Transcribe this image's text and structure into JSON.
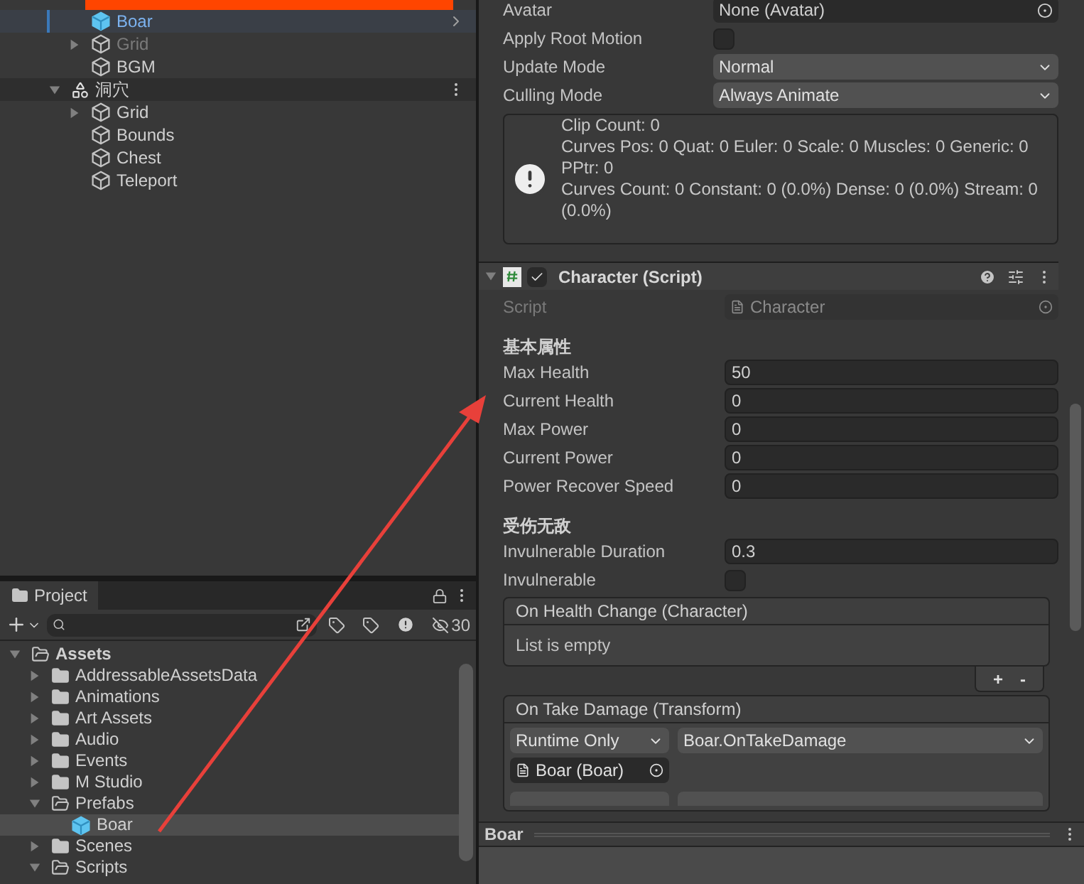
{
  "hierarchy": {
    "items": [
      {
        "label": "Boar",
        "kind": "prefab",
        "selected": true,
        "disabled": false
      },
      {
        "label": "Grid",
        "kind": "object",
        "expanded": false,
        "selected": false,
        "disabled": true
      },
      {
        "label": "BGM",
        "kind": "object",
        "selected": false,
        "disabled": false
      }
    ],
    "scenes": [
      {
        "label": "洞穴",
        "expanded": true,
        "children": [
          {
            "label": "Grid",
            "kind": "object",
            "expanded": false,
            "selected": false,
            "disabled": false
          },
          {
            "label": "Bounds",
            "kind": "object",
            "selected": false,
            "disabled": false
          },
          {
            "label": "Chest",
            "kind": "object",
            "selected": false,
            "disabled": false
          },
          {
            "label": "Teleport",
            "kind": "object",
            "selected": false,
            "disabled": false
          }
        ]
      }
    ]
  },
  "project": {
    "tab": "Project",
    "hidden_count": "30",
    "tree": [
      {
        "label": "Assets",
        "kind": "folder",
        "expanded": true,
        "selected": false,
        "children": [
          {
            "label": "AddressableAssetsData",
            "kind": "folder",
            "expanded": false,
            "selected": false
          },
          {
            "label": "Animations",
            "kind": "folder",
            "expanded": false,
            "selected": false
          },
          {
            "label": "Art Assets",
            "kind": "folder",
            "expanded": false,
            "selected": false
          },
          {
            "label": "Audio",
            "kind": "folder",
            "expanded": false,
            "selected": false
          },
          {
            "label": "Events",
            "kind": "folder",
            "expanded": false,
            "selected": false
          },
          {
            "label": "M Studio",
            "kind": "folder",
            "expanded": false,
            "selected": false
          },
          {
            "label": "Prefabs",
            "kind": "folder",
            "expanded": true,
            "selected": false,
            "children": [
              {
                "label": "Boar",
                "kind": "prefab",
                "selected": true
              }
            ]
          },
          {
            "label": "Scenes",
            "kind": "folder",
            "expanded": false,
            "selected": false
          },
          {
            "label": "Scripts",
            "kind": "folder",
            "expanded": true,
            "selected": false
          }
        ]
      }
    ]
  },
  "inspector": {
    "animator_fields": [
      {
        "label": "Avatar",
        "kind": "object",
        "value": "None (Avatar)"
      },
      {
        "label": "Apply Root Motion",
        "kind": "checkbox",
        "checked": false
      },
      {
        "label": "Update Mode",
        "kind": "dropdown",
        "value": "Normal"
      },
      {
        "label": "Culling Mode",
        "kind": "dropdown",
        "value": "Always Animate"
      }
    ],
    "info_lines": [
      "Clip Count: 0",
      "Curves Pos: 0 Quat: 0 Euler: 0 Scale: 0 Muscles: 0 Generic: 0 PPtr: 0",
      "Curves Count: 0 Constant: 0 (0.0%) Dense: 0 (0.0%) Stream: 0 (0.0%)"
    ],
    "component": {
      "title": "Character (Script)",
      "enabled": true,
      "expanded": true,
      "script_label": "Script",
      "script_value": "Character"
    },
    "sections": [
      {
        "header": "基本属性",
        "fields": [
          {
            "label": "Max Health",
            "kind": "number",
            "value": "50"
          },
          {
            "label": "Current Health",
            "kind": "number",
            "value": "0"
          },
          {
            "label": "Max Power",
            "kind": "number",
            "value": "0"
          },
          {
            "label": "Current Power",
            "kind": "number",
            "value": "0"
          },
          {
            "label": "Power Recover Speed",
            "kind": "number",
            "value": "0"
          }
        ]
      },
      {
        "header": "受伤无敌",
        "fields": [
          {
            "label": "Invulnerable Duration",
            "kind": "number",
            "value": "0.3"
          },
          {
            "label": "Invulnerable",
            "kind": "checkbox",
            "checked": false
          }
        ]
      }
    ],
    "events": [
      {
        "title": "On Health Change (Character)",
        "empty_text": "List is empty",
        "add_label": "+",
        "remove_label": "-"
      },
      {
        "title": "On Take Damage (Transform)",
        "listeners": [
          {
            "mode": "Runtime Only",
            "function": "Boar.OnTakeDamage",
            "target": "Boar (Boar)"
          }
        ]
      }
    ]
  },
  "preview": {
    "title": "Boar"
  }
}
